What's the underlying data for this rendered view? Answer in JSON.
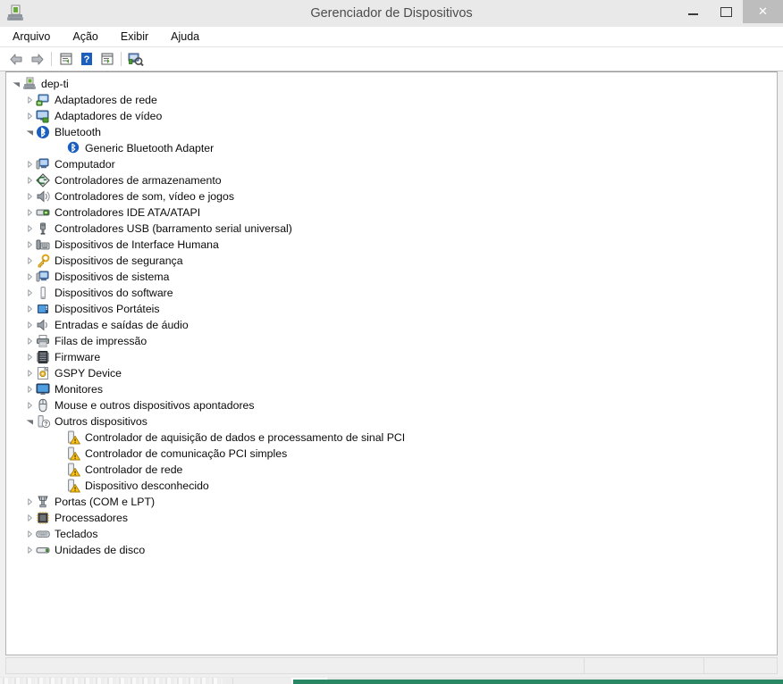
{
  "window": {
    "title": "Gerenciador de Dispositivos",
    "icon": "device-manager-icon",
    "controls": {
      "minimize": "minimize-button",
      "maximize": "maximize-button",
      "close_label": "✕"
    }
  },
  "menubar": {
    "items": [
      {
        "label": "Arquivo",
        "name": "menu-arquivo"
      },
      {
        "label": "Ação",
        "name": "menu-acao"
      },
      {
        "label": "Exibir",
        "name": "menu-exibir"
      },
      {
        "label": "Ajuda",
        "name": "menu-ajuda"
      }
    ]
  },
  "toolbar": {
    "buttons": [
      {
        "name": "back-icon",
        "tip": "Voltar"
      },
      {
        "name": "forward-icon",
        "tip": "Avançar"
      },
      {
        "name": "separator-1",
        "tip": ""
      },
      {
        "name": "properties-icon",
        "tip": "Propriedades"
      },
      {
        "name": "help-icon",
        "tip": "Ajuda"
      },
      {
        "name": "show-details-icon",
        "tip": "Mostrar detalhes"
      },
      {
        "name": "separator-2",
        "tip": ""
      },
      {
        "name": "scan-hardware-changes-icon",
        "tip": "Verificar se há alterações de hardware"
      }
    ]
  },
  "tree": {
    "nodes": [
      {
        "label": "dep-ti",
        "level": 0,
        "state": "expanded",
        "icon": "computer-root-icon",
        "warning": false
      },
      {
        "label": "Adaptadores de rede",
        "level": 1,
        "state": "collapsed",
        "icon": "network-adapter-icon",
        "warning": false
      },
      {
        "label": "Adaptadores de vídeo",
        "level": 1,
        "state": "collapsed",
        "icon": "display-adapter-icon",
        "warning": false
      },
      {
        "label": "Bluetooth",
        "level": 1,
        "state": "expanded",
        "icon": "bluetooth-icon",
        "warning": false
      },
      {
        "label": "Generic Bluetooth Adapter",
        "level": 2,
        "state": "leaf",
        "icon": "bluetooth-device-icon",
        "warning": true
      },
      {
        "label": "Computador",
        "level": 1,
        "state": "collapsed",
        "icon": "computer-icon",
        "warning": false
      },
      {
        "label": "Controladores de armazenamento",
        "level": 1,
        "state": "collapsed",
        "icon": "storage-controller-icon",
        "warning": false
      },
      {
        "label": "Controladores de som, vídeo e jogos",
        "level": 1,
        "state": "collapsed",
        "icon": "sound-controller-icon",
        "warning": false
      },
      {
        "label": "Controladores IDE ATA/ATAPI",
        "level": 1,
        "state": "collapsed",
        "icon": "ide-controller-icon",
        "warning": false
      },
      {
        "label": "Controladores USB (barramento serial universal)",
        "level": 1,
        "state": "collapsed",
        "icon": "usb-controller-icon",
        "warning": false
      },
      {
        "label": "Dispositivos de Interface Humana",
        "level": 1,
        "state": "collapsed",
        "icon": "hid-icon",
        "warning": false
      },
      {
        "label": "Dispositivos de segurança",
        "level": 1,
        "state": "collapsed",
        "icon": "security-device-icon",
        "warning": false
      },
      {
        "label": "Dispositivos de sistema",
        "level": 1,
        "state": "collapsed",
        "icon": "system-device-icon",
        "warning": false
      },
      {
        "label": "Dispositivos do software",
        "level": 1,
        "state": "collapsed",
        "icon": "software-device-icon",
        "warning": false
      },
      {
        "label": "Dispositivos Portáteis",
        "level": 1,
        "state": "collapsed",
        "icon": "portable-device-icon",
        "warning": false
      },
      {
        "label": "Entradas e saídas de áudio",
        "level": 1,
        "state": "collapsed",
        "icon": "audio-io-icon",
        "warning": false
      },
      {
        "label": "Filas de impressão",
        "level": 1,
        "state": "collapsed",
        "icon": "print-queue-icon",
        "warning": false
      },
      {
        "label": "Firmware",
        "level": 1,
        "state": "collapsed",
        "icon": "firmware-icon",
        "warning": false
      },
      {
        "label": "GSPY Device",
        "level": 1,
        "state": "collapsed",
        "icon": "gspy-device-icon",
        "warning": false
      },
      {
        "label": "Monitores",
        "level": 1,
        "state": "collapsed",
        "icon": "monitor-icon",
        "warning": false
      },
      {
        "label": "Mouse e outros dispositivos apontadores",
        "level": 1,
        "state": "collapsed",
        "icon": "mouse-icon",
        "warning": false
      },
      {
        "label": "Outros dispositivos",
        "level": 1,
        "state": "expanded",
        "icon": "other-devices-icon",
        "warning": false
      },
      {
        "label": "Controlador de aquisição de dados e processamento de sinal PCI",
        "level": 2,
        "state": "leaf",
        "icon": "unknown-device-icon",
        "warning": true
      },
      {
        "label": "Controlador de comunicação PCI simples",
        "level": 2,
        "state": "leaf",
        "icon": "unknown-device-icon",
        "warning": true
      },
      {
        "label": "Controlador de rede",
        "level": 2,
        "state": "leaf",
        "icon": "unknown-device-icon",
        "warning": true
      },
      {
        "label": "Dispositivo desconhecido",
        "level": 2,
        "state": "leaf",
        "icon": "unknown-device-icon",
        "warning": true
      },
      {
        "label": "Portas (COM e LPT)",
        "level": 1,
        "state": "collapsed",
        "icon": "ports-icon",
        "warning": false
      },
      {
        "label": "Processadores",
        "level": 1,
        "state": "collapsed",
        "icon": "processor-icon",
        "warning": false
      },
      {
        "label": "Teclados",
        "level": 1,
        "state": "collapsed",
        "icon": "keyboard-icon",
        "warning": false
      },
      {
        "label": "Unidades de disco",
        "level": 1,
        "state": "collapsed",
        "icon": "disk-drive-icon",
        "warning": false
      }
    ]
  },
  "statusbar": {
    "panes": [
      "",
      "",
      ""
    ]
  },
  "colors": {
    "titlebar": "#e9e9e9",
    "title_text": "#4c4c4c",
    "close_button": "#bdbdbd",
    "panel_bg": "#ffffff",
    "chrome": "#f0f0f0",
    "taskbar_accent": "#2a8763",
    "warning": "#ffc20e"
  }
}
